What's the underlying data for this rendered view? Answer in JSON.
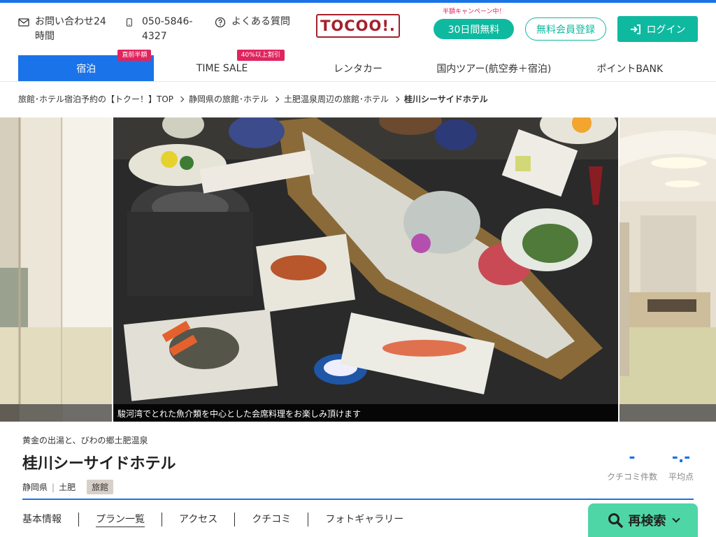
{
  "header": {
    "contact_label": "お問い合わせ24時間",
    "phone": "050-5846-4327",
    "faq_label": "よくある質問",
    "logo_text": "TOCOO!.",
    "campaign_note": "半額キャンペーン中！",
    "trial_button": "30日間無料",
    "register_button": "無料会員登録",
    "login_button": "ログイン"
  },
  "nav": {
    "items": [
      {
        "label": "宿泊",
        "badge": "直前半額"
      },
      {
        "label": "TIME SALE",
        "badge": "40%以上割引"
      },
      {
        "label": "レンタカー",
        "badge": ""
      },
      {
        "label": "国内ツアー(航空券＋宿泊)",
        "badge": ""
      },
      {
        "label": "ポイントBANK",
        "badge": ""
      }
    ]
  },
  "breadcrumb": [
    "旅館･ホテル宿泊予約の【トクー！】TOP",
    "静岡県の旅館･ホテル",
    "土肥温泉周辺の旅館･ホテル",
    "桂川シーサイドホテル"
  ],
  "gallery": {
    "main_caption": "駿河湾でとれた魚介類を中心とした会席料理をお楽しみ頂けます"
  },
  "hotel": {
    "catchphrase": "黄金の出湯と、びわの郷土肥温泉",
    "name": "桂川シーサイドホテル",
    "prefecture": "静岡県",
    "area": "土肥",
    "category": "旅館",
    "review_count": "-",
    "review_count_label": "クチコミ件数",
    "average_score": "-.-",
    "average_score_label": "平均点"
  },
  "tabs": [
    "基本情報",
    "プラン一覧",
    "アクセス",
    "クチコミ",
    "フォトギャラリー"
  ],
  "search_button": "再検索",
  "colors": {
    "primary_blue": "#1a73e8",
    "teal": "#0fb9a0",
    "logo_red": "#a3212c",
    "badge_pink": "#e0245e",
    "search_green": "#4fd6a6"
  }
}
